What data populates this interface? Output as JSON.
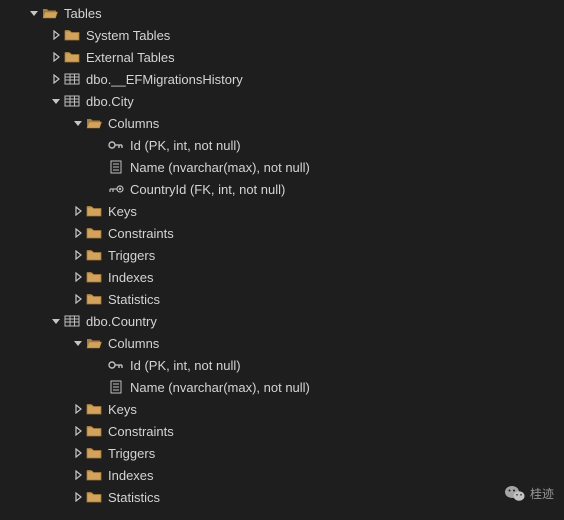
{
  "tree": {
    "root": {
      "label": "Tables",
      "children": [
        {
          "label": "System Tables",
          "icon": "folder",
          "expanded": false,
          "hasChildren": true
        },
        {
          "label": "External Tables",
          "icon": "folder",
          "expanded": false,
          "hasChildren": true
        },
        {
          "label": "dbo.__EFMigrationsHistory",
          "icon": "table",
          "expanded": false,
          "hasChildren": true
        },
        {
          "label": "dbo.City",
          "icon": "table",
          "expanded": true,
          "children": [
            {
              "label": "Columns",
              "icon": "folder-open",
              "expanded": true,
              "children": [
                {
                  "label": "Id (PK, int, not null)",
                  "icon": "key"
                },
                {
                  "label": "Name (nvarchar(max), not null)",
                  "icon": "column"
                },
                {
                  "label": "CountryId (FK, int, not null)",
                  "icon": "fk"
                }
              ]
            },
            {
              "label": "Keys",
              "icon": "folder",
              "expanded": false,
              "hasChildren": true
            },
            {
              "label": "Constraints",
              "icon": "folder",
              "expanded": false,
              "hasChildren": true
            },
            {
              "label": "Triggers",
              "icon": "folder",
              "expanded": false,
              "hasChildren": true
            },
            {
              "label": "Indexes",
              "icon": "folder",
              "expanded": false,
              "hasChildren": true
            },
            {
              "label": "Statistics",
              "icon": "folder",
              "expanded": false,
              "hasChildren": true
            }
          ]
        },
        {
          "label": "dbo.Country",
          "icon": "table",
          "expanded": true,
          "children": [
            {
              "label": "Columns",
              "icon": "folder-open",
              "expanded": true,
              "children": [
                {
                  "label": "Id (PK, int, not null)",
                  "icon": "key"
                },
                {
                  "label": "Name (nvarchar(max), not null)",
                  "icon": "column"
                }
              ]
            },
            {
              "label": "Keys",
              "icon": "folder",
              "expanded": false,
              "hasChildren": true
            },
            {
              "label": "Constraints",
              "icon": "folder",
              "expanded": false,
              "hasChildren": true
            },
            {
              "label": "Triggers",
              "icon": "folder",
              "expanded": false,
              "hasChildren": true
            },
            {
              "label": "Indexes",
              "icon": "folder",
              "expanded": false,
              "hasChildren": true
            },
            {
              "label": "Statistics",
              "icon": "folder",
              "expanded": false,
              "hasChildren": true
            }
          ]
        }
      ]
    }
  },
  "branding": {
    "label": "桂迹"
  },
  "colors": {
    "folder": "#d1a35c",
    "folderDark": "#a67a38",
    "icon": "#bfbfbf",
    "arrow": "#c5c5c5"
  }
}
